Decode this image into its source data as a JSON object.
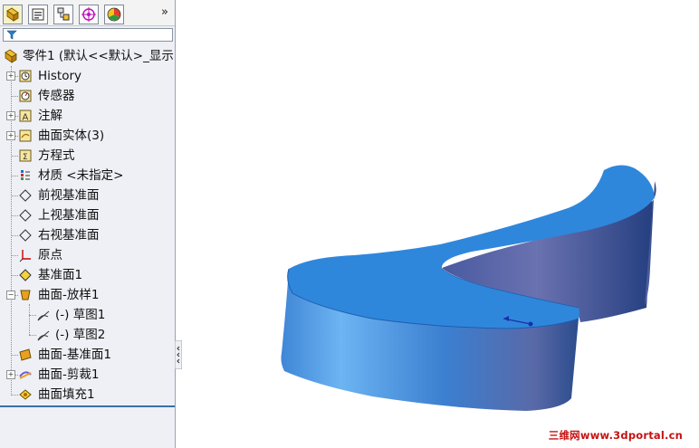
{
  "tree": {
    "root_label": "零件1  (默认<<默认>_显示",
    "items": [
      {
        "label": "History",
        "icon": "history-icon",
        "expandable": true
      },
      {
        "label": "传感器",
        "icon": "sensor-icon",
        "expandable": false
      },
      {
        "label": "注解",
        "icon": "annotation-icon",
        "expandable": true
      },
      {
        "label": "曲面实体(3)",
        "icon": "surface-bodies-icon",
        "expandable": true
      },
      {
        "label": "方程式",
        "icon": "equation-icon",
        "expandable": false
      },
      {
        "label": "材质 <未指定>",
        "icon": "material-icon",
        "expandable": false
      },
      {
        "label": "前视基准面",
        "icon": "plane-icon",
        "expandable": false
      },
      {
        "label": "上视基准面",
        "icon": "plane-icon",
        "expandable": false
      },
      {
        "label": "右视基准面",
        "icon": "plane-icon",
        "expandable": false
      },
      {
        "label": "原点",
        "icon": "origin-icon",
        "expandable": false
      },
      {
        "label": "基准面1",
        "icon": "plane-yellow-icon",
        "expandable": false
      },
      {
        "label": "曲面-放样1",
        "icon": "loft-surface-icon",
        "expandable": true,
        "expanded": true
      },
      {
        "label": "(-) 草图1",
        "icon": "sketch-icon",
        "child": true
      },
      {
        "label": "(-) 草图2",
        "icon": "sketch-icon",
        "child": true
      },
      {
        "label": "曲面-基准面1",
        "icon": "planar-surface-icon",
        "expandable": false
      },
      {
        "label": "曲面-剪裁1",
        "icon": "trim-surface-icon",
        "expandable": true
      },
      {
        "label": "曲面填充1",
        "icon": "fill-surface-icon",
        "expandable": false
      }
    ]
  },
  "tabs": [
    {
      "name": "feature-manager-tab",
      "icon": "feature-tree-icon"
    },
    {
      "name": "property-manager-tab",
      "icon": "property-icon"
    },
    {
      "name": "configuration-manager-tab",
      "icon": "configuration-icon"
    },
    {
      "name": "dimxpert-tab",
      "icon": "target-icon"
    },
    {
      "name": "display-manager-tab",
      "icon": "color-wheel-icon"
    }
  ],
  "expand_glyph": "»",
  "watermark": "三维网www.3dportal.cn",
  "colors": {
    "surface_top": "#2f87dc",
    "surface_side_light": "#5aa9ec",
    "surface_side_dark": "#2b4c8c",
    "watermark": "#c51212"
  }
}
